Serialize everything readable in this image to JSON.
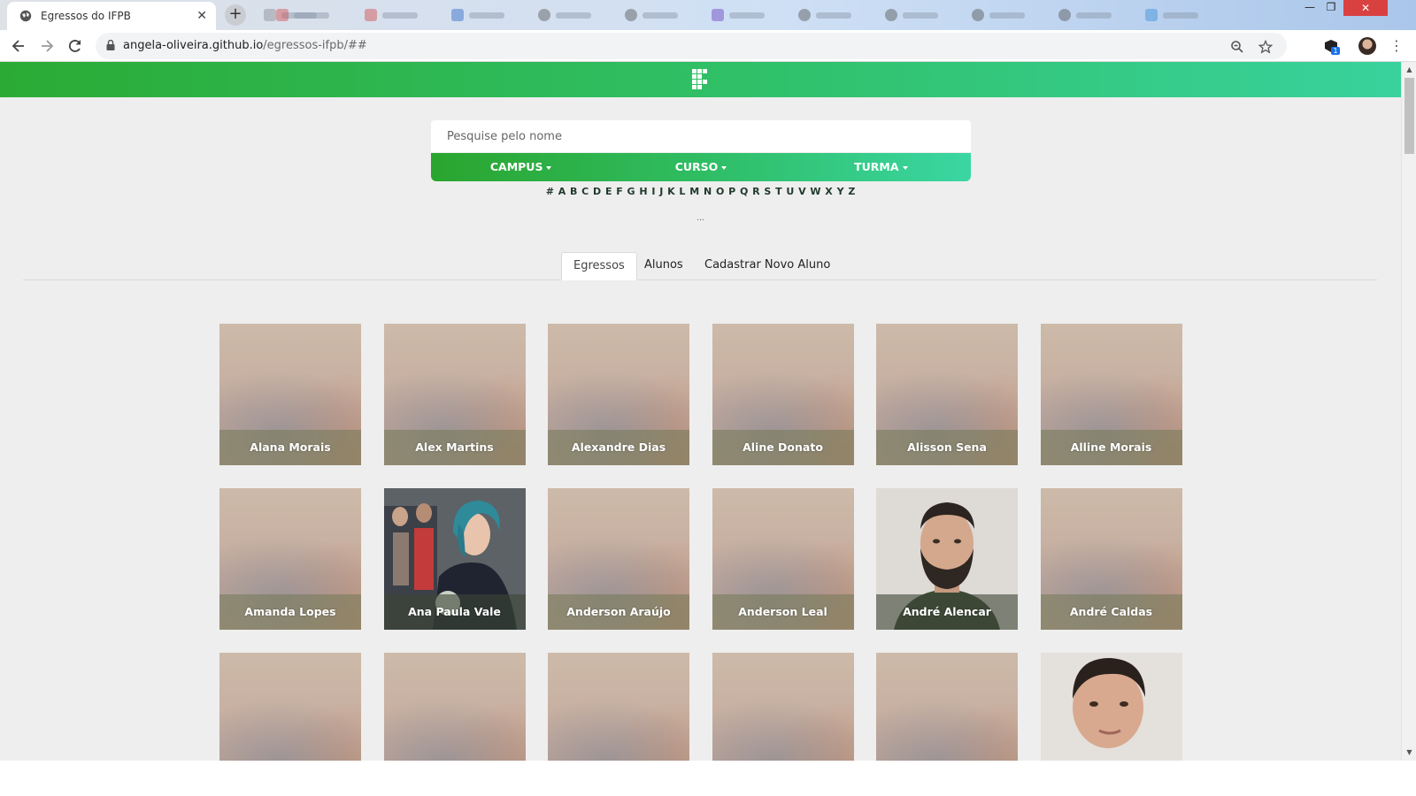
{
  "browser": {
    "tab_title": "Egressos do IFPB",
    "url_host": "angela-oliveira.github.io",
    "url_path": "/egressos-ifpb/##",
    "win_min": "—",
    "win_restore": "❐",
    "win_close": "✕",
    "extension_badge": "1"
  },
  "search": {
    "placeholder": "Pesquise pelo nome"
  },
  "filters": [
    {
      "label": "CAMPUS"
    },
    {
      "label": "CURSO"
    },
    {
      "label": "TURMA"
    }
  ],
  "letters": [
    "#",
    "A",
    "B",
    "C",
    "D",
    "E",
    "F",
    "G",
    "H",
    "I",
    "J",
    "K",
    "L",
    "M",
    "N",
    "O",
    "P",
    "Q",
    "R",
    "S",
    "T",
    "U",
    "V",
    "W",
    "X",
    "Y",
    "Z"
  ],
  "dots": "...",
  "tabs": [
    {
      "label": "Egressos",
      "active": true
    },
    {
      "label": "Alunos",
      "active": false
    },
    {
      "label": "Cadastrar Novo Aluno",
      "active": false
    }
  ],
  "students": [
    {
      "name": "Alana Morais"
    },
    {
      "name": "Alex Martins"
    },
    {
      "name": "Alexandre Dias"
    },
    {
      "name": "Aline Donato"
    },
    {
      "name": "Alisson Sena"
    },
    {
      "name": "Alline Morais"
    },
    {
      "name": "Amanda Lopes"
    },
    {
      "name": "Ana Paula Vale"
    },
    {
      "name": "Anderson Araújo"
    },
    {
      "name": "Anderson Leal"
    },
    {
      "name": "André Alencar"
    },
    {
      "name": "André Caldas"
    }
  ],
  "colors": {
    "header_start": "#2bab35",
    "header_end": "#39d29d",
    "page_bg": "#eeeeee"
  }
}
